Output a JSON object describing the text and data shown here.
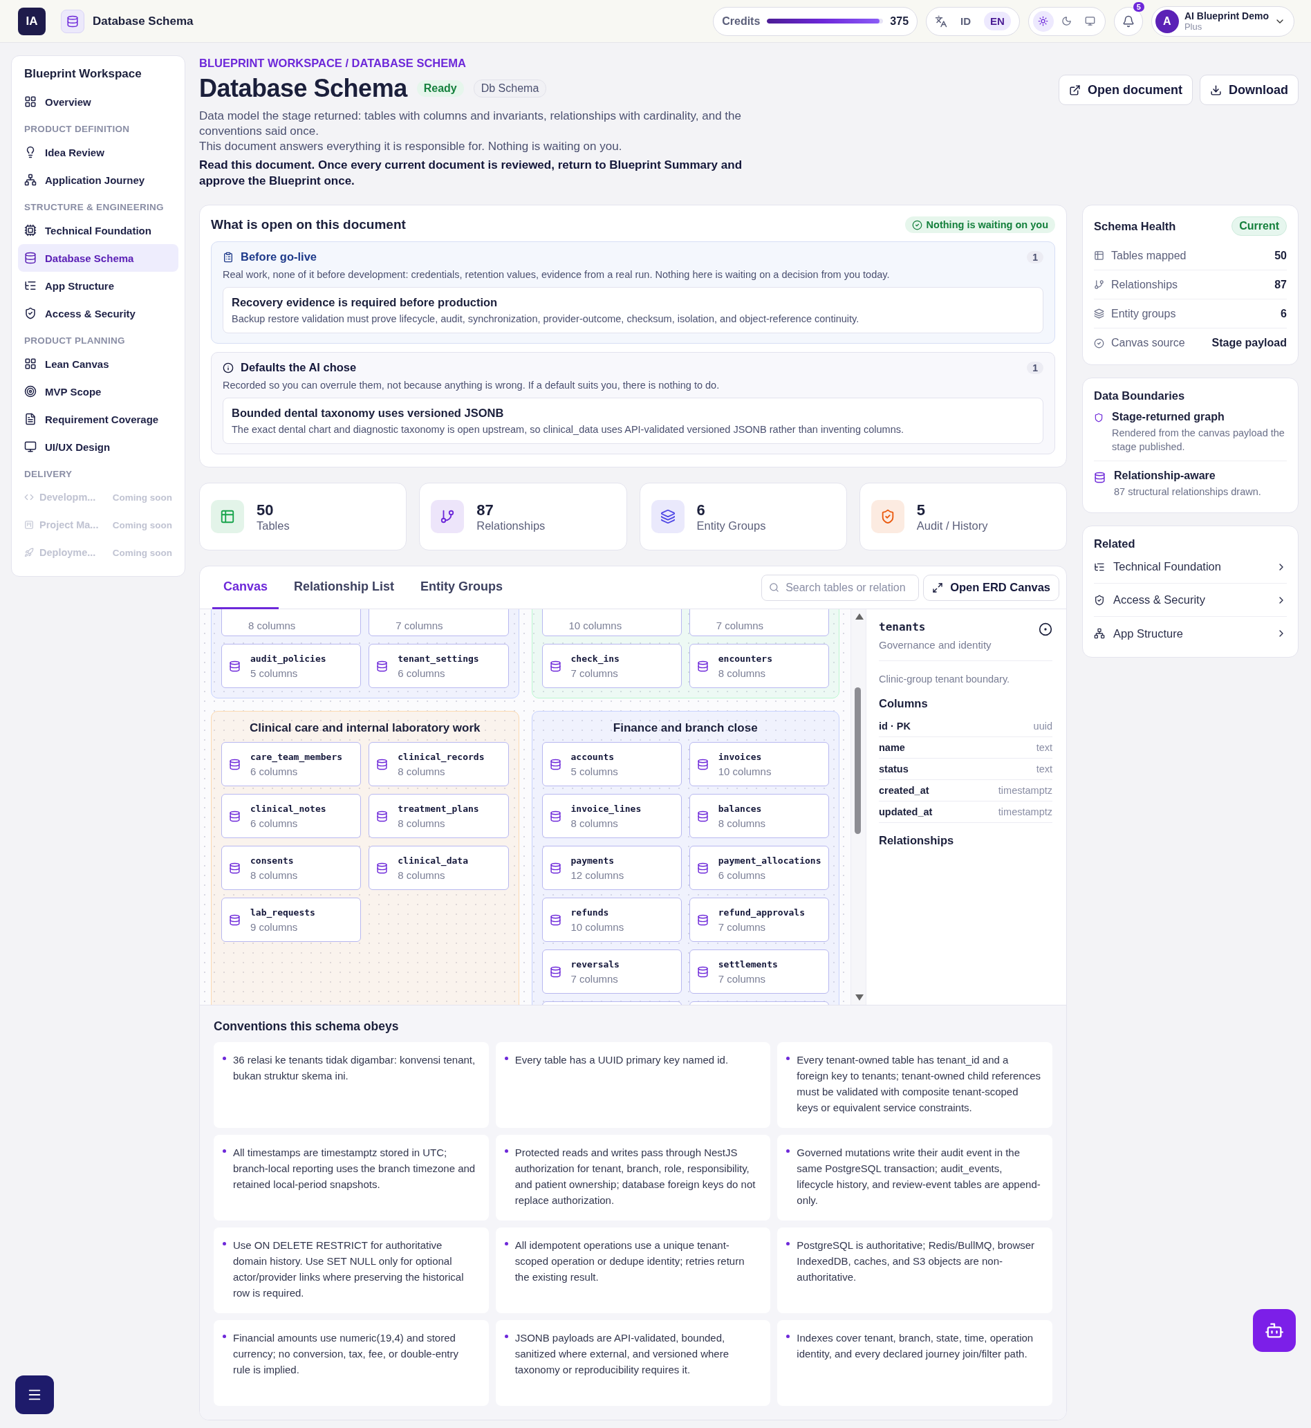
{
  "topbar": {
    "logo": "IA",
    "page_title": "Database Schema",
    "credits": {
      "label": "Credits",
      "level": 0.97,
      "value": "375"
    },
    "languages": [
      {
        "label": "ID",
        "selected": false
      },
      {
        "label": "EN",
        "selected": true
      }
    ],
    "theme_modes": [
      {
        "kind": "light",
        "selected": true
      },
      {
        "kind": "dark",
        "selected": false
      },
      {
        "kind": "system",
        "selected": false
      }
    ],
    "notifications": "5",
    "user": {
      "initial": "A",
      "name": "AI Blueprint Demo",
      "plan": "Plus"
    }
  },
  "sidebar": {
    "title": "Blueprint Workspace",
    "items": [
      {
        "kind": "item",
        "label": "Overview",
        "selected": false
      },
      {
        "kind": "section",
        "label": "PRODUCT DEFINITION"
      },
      {
        "kind": "item",
        "label": "Idea Review",
        "selected": false
      },
      {
        "kind": "item",
        "label": "Application Journey",
        "selected": false
      },
      {
        "kind": "section",
        "label": "STRUCTURE & ENGINEERING"
      },
      {
        "kind": "item",
        "label": "Technical Foundation",
        "selected": false
      },
      {
        "kind": "item",
        "label": "Database Schema",
        "selected": true
      },
      {
        "kind": "item",
        "label": "App Structure",
        "selected": false
      },
      {
        "kind": "item",
        "label": "Access & Security",
        "selected": false
      },
      {
        "kind": "section",
        "label": "PRODUCT PLANNING"
      },
      {
        "kind": "item",
        "label": "Lean Canvas",
        "selected": false
      },
      {
        "kind": "item",
        "label": "MVP Scope",
        "selected": false
      },
      {
        "kind": "item",
        "label": "Requirement Coverage",
        "selected": false
      },
      {
        "kind": "item",
        "label": "UI/UX Design",
        "selected": false
      },
      {
        "kind": "section",
        "label": "DELIVERY"
      },
      {
        "kind": "disabled",
        "label": "Developm...",
        "note": "Coming soon"
      },
      {
        "kind": "disabled",
        "label": "Project Ma...",
        "note": "Coming soon"
      },
      {
        "kind": "disabled",
        "label": "Deployme...",
        "note": "Coming soon"
      }
    ]
  },
  "header": {
    "breadcrumb": "BLUEPRINT WORKSPACE / DATABASE SCHEMA",
    "title": "Database Schema",
    "status": "Ready",
    "tag": "Db Schema",
    "buttons": [
      "Open document",
      "Download"
    ],
    "description": "Data model the stage returned: tables with columns and invariants, relationships with cardinality, and the conventions said once.",
    "note": "This document answers everything it is responsible for. Nothing is waiting on you.",
    "instruction": "Read this document. Once every current document is reviewed, return to Blueprint Summary and approve the Blueprint once."
  },
  "open_items": {
    "title": "What is open on this document",
    "status": "Nothing is waiting on you",
    "sections": [
      {
        "kind": "golive",
        "title": "Before go-live",
        "count": "1",
        "text": "Real work, none of it before development: credentials, retention values, evidence from a real run. Nothing here is waiting on a decision from you today.",
        "item_title": "Recovery evidence is required before production",
        "item_text": "Backup restore validation must prove lifecycle, audit, synchronization, provider-outcome, checksum, isolation, and object-reference continuity."
      },
      {
        "kind": "defaults",
        "title": "Defaults the AI chose",
        "count": "1",
        "text": "Recorded so you can overrule them, not because anything is wrong. If a default suits you, there is nothing to do.",
        "item_title": "Bounded dental taxonomy uses versioned JSONB",
        "item_text": "The exact dental chart and diagnostic taxonomy is open upstream, so clinical_data uses API-validated versioned JSONB rather than inventing columns."
      }
    ]
  },
  "stats": [
    {
      "value": "50",
      "label": "Tables",
      "color": "#16a34a"
    },
    {
      "value": "87",
      "label": "Relationships",
      "color": "#6d28d9"
    },
    {
      "value": "6",
      "label": "Entity Groups",
      "color": "#4f46e5"
    },
    {
      "value": "5",
      "label": "Audit / History",
      "color": "#ea580c"
    }
  ],
  "canvas": {
    "tabs": [
      {
        "label": "Canvas",
        "selected": true
      },
      {
        "label": "Relationship List",
        "selected": false
      },
      {
        "label": "Entity Groups",
        "selected": false
      }
    ],
    "search": {
      "placeholder": "Search tables or relation"
    },
    "open_button": "Open ERD Canvas",
    "groups": [
      {
        "color": "#c7d2fe",
        "tables": [
          {
            "kind": "cut_top",
            "columns": "8 columns"
          },
          {
            "kind": "cut_top",
            "columns": "7 columns"
          },
          {
            "kind": "table",
            "name": "audit_policies",
            "columns": "5 columns"
          },
          {
            "kind": "table",
            "name": "tenant_settings",
            "columns": "6 columns"
          }
        ]
      },
      {
        "color": "#bbf7d0",
        "tables": [
          {
            "kind": "cut_top",
            "columns": "10 columns"
          },
          {
            "kind": "cut_top",
            "columns": "7 columns"
          },
          {
            "kind": "table",
            "name": "check_ins",
            "columns": "7 columns"
          },
          {
            "kind": "table",
            "name": "encounters",
            "columns": "8 columns"
          }
        ]
      },
      {
        "color": "#fcd9b0",
        "title": "Clinical care and internal laboratory work",
        "tables": [
          {
            "kind": "table",
            "name": "care_team_members",
            "columns": "6 columns"
          },
          {
            "kind": "table",
            "name": "clinical_records",
            "columns": "8 columns"
          },
          {
            "kind": "table",
            "name": "clinical_notes",
            "columns": "6 columns"
          },
          {
            "kind": "table",
            "name": "treatment_plans",
            "columns": "8 columns"
          },
          {
            "kind": "table",
            "name": "consents",
            "columns": "8 columns"
          },
          {
            "kind": "table",
            "name": "clinical_data",
            "columns": "8 columns"
          },
          {
            "kind": "table",
            "name": "lab_requests",
            "columns": "9 columns"
          }
        ]
      },
      {
        "color": "#c7d2fe",
        "title": "Finance and branch close",
        "tables": [
          {
            "kind": "table",
            "name": "accounts",
            "columns": "5 columns"
          },
          {
            "kind": "table",
            "name": "invoices",
            "columns": "10 columns"
          },
          {
            "kind": "table",
            "name": "invoice_lines",
            "columns": "8 columns"
          },
          {
            "kind": "table",
            "name": "balances",
            "columns": "8 columns"
          },
          {
            "kind": "table",
            "name": "payments",
            "columns": "12 columns"
          },
          {
            "kind": "table",
            "name": "payment_allocations",
            "columns": "6 columns"
          },
          {
            "kind": "table",
            "name": "refunds",
            "columns": "10 columns"
          },
          {
            "kind": "table",
            "name": "refund_approvals",
            "columns": "7 columns"
          },
          {
            "kind": "table",
            "name": "reversals",
            "columns": "7 columns"
          },
          {
            "kind": "table",
            "name": "settlements",
            "columns": "7 columns"
          },
          {
            "kind": "cut_bottom"
          },
          {
            "kind": "cut_bottom"
          }
        ]
      }
    ],
    "detail": {
      "name": "tenants",
      "group": "Governance and identity",
      "description": "Clinic-group tenant boundary.",
      "columns_title": "Columns",
      "columns": [
        {
          "name": "id · PK",
          "type": "uuid"
        },
        {
          "name": "name",
          "type": "text"
        },
        {
          "name": "status",
          "type": "text"
        },
        {
          "name": "created_at",
          "type": "timestamptz"
        },
        {
          "name": "updated_at",
          "type": "timestamptz"
        }
      ],
      "relationships_title": "Relationships"
    }
  },
  "conventions": {
    "title": "Conventions this schema obeys",
    "items": [
      "36 relasi ke tenants tidak digambar: konvensi tenant, bukan struktur skema ini.",
      "Every table has a UUID primary key named id.",
      "Every tenant-owned table has tenant_id and a foreign key to tenants; tenant-owned child references must be validated with composite tenant-scoped keys or equivalent service constraints.",
      "All timestamps are timestamptz stored in UTC; branch-local reporting uses the branch timezone and retained local-period snapshots.",
      "Protected reads and writes pass through NestJS authorization for tenant, branch, role, responsibility, and patient ownership; database foreign keys do not replace authorization.",
      "Governed mutations write their audit event in the same PostgreSQL transaction; audit_events, lifecycle history, and review-event tables are append-only.",
      "Use ON DELETE RESTRICT for authoritative domain history. Use SET NULL only for optional actor/provider links where preserving the historical row is required.",
      "All idempotent operations use a unique tenant-scoped operation or dedupe identity; retries return the existing result.",
      "PostgreSQL is authoritative; Redis/BullMQ, browser IndexedDB, caches, and S3 objects are non-authoritative.",
      "Financial amounts use numeric(19,4) and stored currency; no conversion, tax, fee, or double-entry rule is implied.",
      "JSONB payloads are API-validated, bounded, sanitized where external, and versioned where taxonomy or reproducibility requires it.",
      "Indexes cover tenant, branch, state, time, operation identity, and every declared journey join/filter path."
    ]
  },
  "right": {
    "health": {
      "title": "Schema Health",
      "badge": "Current",
      "rows": [
        {
          "label": "Tables mapped",
          "value": "50"
        },
        {
          "label": "Relationships",
          "value": "87"
        },
        {
          "label": "Entity groups",
          "value": "6"
        },
        {
          "label": "Canvas source",
          "value": "Stage payload"
        }
      ]
    },
    "boundaries": {
      "title": "Data Boundaries",
      "items": [
        {
          "title": "Stage-returned graph",
          "text": "Rendered from the canvas payload the stage published."
        },
        {
          "title": "Relationship-aware",
          "text": "87 structural relationships drawn."
        }
      ]
    },
    "related": {
      "title": "Related",
      "items": [
        "Technical Foundation",
        "Access & Security",
        "App Structure"
      ]
    }
  }
}
